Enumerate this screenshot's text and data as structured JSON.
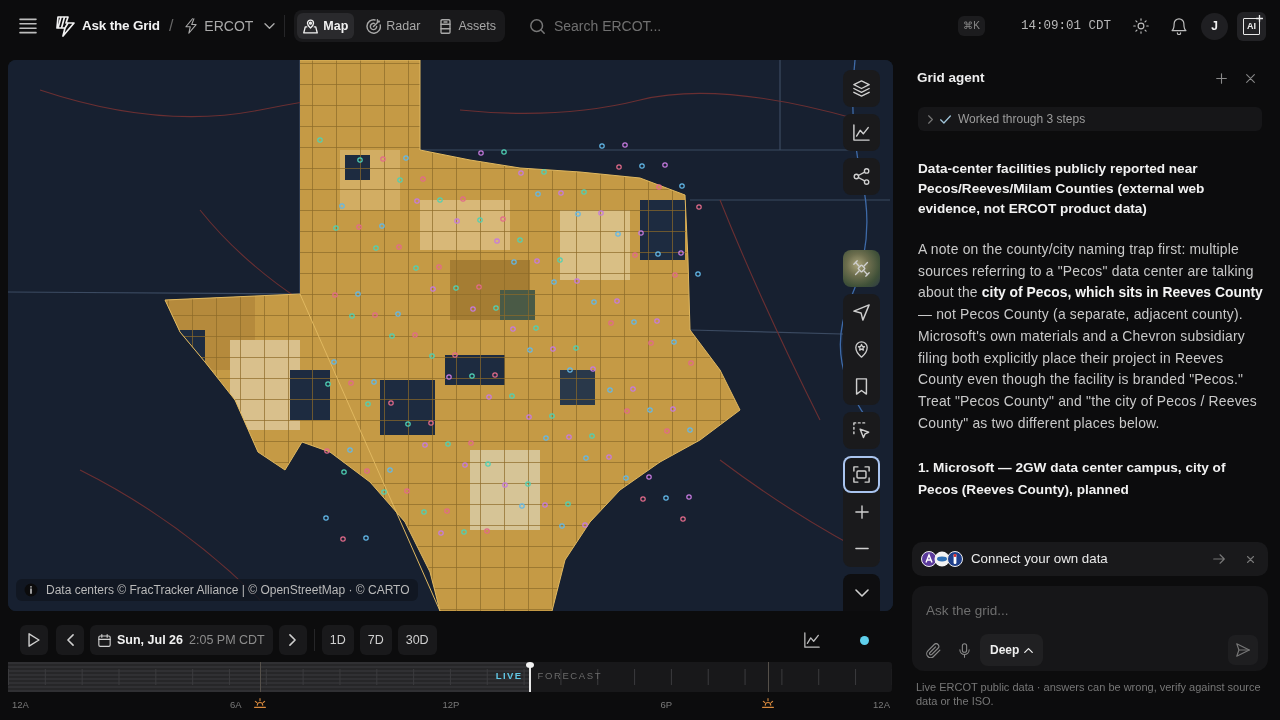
{
  "topbar": {
    "brand": "Ask the Grid",
    "separator": "/",
    "region": "ERCOT",
    "nav": [
      {
        "label": "Map",
        "kind": "map",
        "selected": true
      },
      {
        "label": "Radar",
        "kind": "radar",
        "selected": false
      },
      {
        "label": "Assets",
        "kind": "assets",
        "selected": false
      }
    ],
    "search": {
      "placeholder": "Search ERCOT..."
    },
    "shortcut": "⌘K",
    "clock": "14:09:01 CDT",
    "avatar": "J",
    "ai_label": "AI"
  },
  "map": {
    "attribution": "Data centers © FracTracker Alliance | © OpenStreetMap · © CARTO",
    "tool_groups": [
      [
        {
          "kind": "layers",
          "selected": false
        }
      ],
      [
        {
          "kind": "chart",
          "selected": false
        }
      ],
      [
        {
          "kind": "share",
          "selected": false
        }
      ],
      [
        {
          "kind": "basemap",
          "selected": false
        }
      ],
      [
        {
          "kind": "navigate",
          "selected": false
        },
        {
          "kind": "pin",
          "selected": false
        },
        {
          "kind": "bookmark",
          "selected": false
        }
      ],
      [
        {
          "kind": "select",
          "selected": false
        }
      ],
      [
        {
          "kind": "fit",
          "selected": true
        },
        {
          "kind": "zoom_in",
          "selected": false
        },
        {
          "kind": "zoom_out",
          "selected": false
        }
      ],
      [
        {
          "kind": "collapse",
          "selected": false
        }
      ]
    ]
  },
  "playback": {
    "date": "Sun, Jul 26",
    "time": "2:05 PM CDT",
    "ranges": [
      {
        "label": "1D",
        "selected": false
      },
      {
        "label": "7D",
        "selected": false
      },
      {
        "label": "30D",
        "selected": false
      }
    ]
  },
  "timeline": {
    "live": "LIVE",
    "forecast": "FORECAST",
    "level": 0.59,
    "hours": [
      "12A",
      "6A",
      "12P",
      "6P",
      "12A"
    ]
  },
  "agent": {
    "title": "Grid agent",
    "steps": {
      "label": "Worked through 3 steps",
      "expanded": false
    },
    "messages": [
      {
        "kind": "heading",
        "text": "Data-center facilities publicly reported near Pecos/Reeves/Milam Counties (external web evidence, not ERCOT product data)"
      },
      {
        "kind": "paragraph",
        "text": "A note on the county/city naming trap first: multiple sources referring to a \"Pecos\" data center are talking about the **city of Pecos, which sits in Reeves County** — not Pecos County (a separate, adjacent county). Microsoft's own materials and a Chevron subsidiary filing both explicitly place their project in Reeves County even though the facility is branded \"Pecos.\" Treat \"Pecos County\" and \"the city of Pecos / Reeves County\" as two different places below."
      },
      {
        "kind": "heading",
        "text": "1. Microsoft — 2GW data center campus, city of Pecos (Reeves County), planned"
      }
    ],
    "connect": {
      "label": "Connect your own data"
    },
    "composer": {
      "placeholder": "Ask the grid...",
      "mode": "Deep"
    },
    "footer": "Live ERCOT public data · answers can be wrong, verify against source data or the ISO."
  }
}
